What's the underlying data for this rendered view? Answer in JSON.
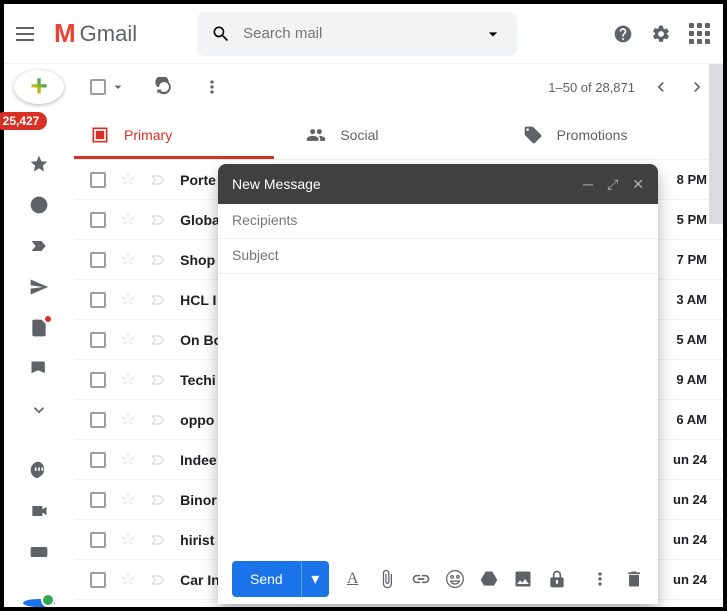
{
  "header": {
    "app_name": "Gmail",
    "search_placeholder": "Search mail"
  },
  "sidebar": {
    "badge": "25,427"
  },
  "toolbar": {
    "pagination": "1–50 of 28,871"
  },
  "tabs": [
    {
      "label": "Primary"
    },
    {
      "label": "Social"
    },
    {
      "label": "Promotions"
    }
  ],
  "mails": [
    {
      "sender": "Porte",
      "time": "8 PM"
    },
    {
      "sender": "Globa",
      "time": "5 PM"
    },
    {
      "sender": "Shop",
      "time": "7 PM"
    },
    {
      "sender": "HCL I",
      "time": "3 AM"
    },
    {
      "sender": "On Bo",
      "time": "5 AM"
    },
    {
      "sender": "Techi",
      "time": "9 AM"
    },
    {
      "sender": "oppo",
      "time": "6 AM"
    },
    {
      "sender": "Indee",
      "time": "un 24"
    },
    {
      "sender": "Binor",
      "time": "un 24"
    },
    {
      "sender": "hirist",
      "time": "un 24"
    },
    {
      "sender": "Car In",
      "time": "un 24"
    }
  ],
  "compose": {
    "title": "New Message",
    "recipients_placeholder": "Recipients",
    "subject_placeholder": "Subject",
    "send_label": "Send"
  }
}
